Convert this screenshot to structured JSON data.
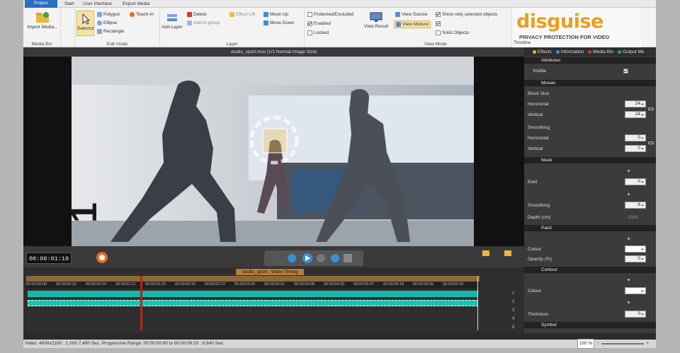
{
  "tabs": [
    "Project",
    "Start",
    "User Interface",
    "Export Media"
  ],
  "ribbon": {
    "media_bin": {
      "import": "Import Media...",
      "label": "Media Bin"
    },
    "edit_mode": {
      "selector": "Selector",
      "polygon": "Polygon",
      "ellipse": "Ellipse",
      "rectangle": "Rectangle",
      "teach_in": "Teach-In",
      "label": "Edit mode"
    },
    "layer": {
      "add_layer": "Add Layer",
      "delete": "Delete",
      "add_to_group": "Add to group",
      "effect_lift": "Effect Lift",
      "move_up": "Move Up",
      "move_down": "Move Down",
      "protected": "Protected/Excluded",
      "enabled": "Enabled",
      "locked": "Locked",
      "label": "Layer"
    },
    "view_mode": {
      "view_result": "View Result",
      "view_source": "View Source",
      "view_mixture": "View Mixture",
      "show_only": "Show only selected objects",
      "solid_objects": "Solid Objects",
      "label": "View Mode"
    },
    "timeline_label": "Timeline"
  },
  "logo": {
    "word": "disguise",
    "tagline": "PRIVACY PROTECTION FOR VIDEO"
  },
  "video": {
    "header": "studio_sport.mov  (1/1  Normal Image Size)"
  },
  "right_panel": {
    "tabs": [
      "Effects",
      "Information",
      "Media Bin",
      "Output Me"
    ],
    "attributes": "Attributes",
    "visible": "Visible",
    "mosaic": "Mosaic",
    "block_size": "Block Size",
    "horizontal": "Horizontal",
    "vertical": "Vertical",
    "bs_h": "24",
    "bs_v": "24",
    "smoothing": "Smoothing",
    "sm_h": "0",
    "sm_v": "0",
    "mask": "Mask",
    "bold": "Bold",
    "bold_v": "0",
    "mask_smoothing": "Smoothing",
    "mask_sm_v": "6",
    "depth": "Depth (cm)",
    "depth_v": "1000",
    "paint": "Paint",
    "colour": "Colour",
    "opacity": "Opacity (%)",
    "opacity_v": "0",
    "contour": "Contour",
    "c_colour": "Colour",
    "thickness": "Thickness",
    "thickness_v": "0",
    "symbol": "Symbol"
  },
  "transport": {
    "timecode": "00:00:01:18"
  },
  "timeline": {
    "title": "studio_sport - Video Timing",
    "ticks": [
      "00:00:00:00",
      "00:00:00:12",
      "00:00:00:24",
      "00:00:01:11",
      "00:00:01:23",
      "00:00:02:10",
      "00:00:02:22",
      "00:00:03:09",
      "00:00:03:21",
      "00:00:04:08",
      "00:00:04:20",
      "00:00:05:07",
      "00:00:05:19",
      "00:00:06:06",
      "00:00:06:18"
    ],
    "track_numbers": [
      "1",
      "2",
      "3",
      "4",
      "5"
    ]
  },
  "status": {
    "text": "Video: 4608x2160 ; 1,000   7,480 Sec.   Progressive   Range: 00:00:00:00 to 00:00:06:20 ; 6,840 Sec.",
    "zoom": "100 %"
  },
  "colors": {
    "accent": "#2b6cc4",
    "track": "#18b7a8",
    "playhead": "#c0201a",
    "logo": "#e8a01c"
  }
}
